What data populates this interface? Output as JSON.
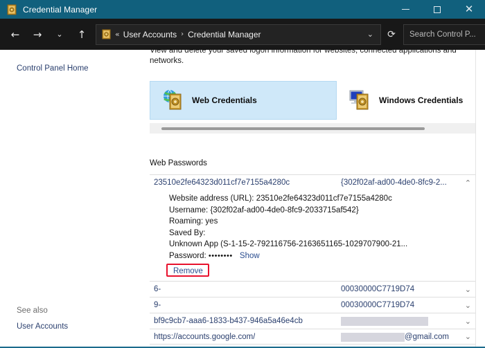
{
  "window": {
    "title": "Credential Manager",
    "icon": "vault-icon",
    "controls": {
      "minimize": "minimize-icon",
      "maximize": "maximize-icon",
      "close": "close-icon"
    }
  },
  "toolbar": {
    "back": "back-arrow-icon",
    "forward": "forward-arrow-icon",
    "recent": "chevron-down-icon",
    "up": "up-arrow-icon",
    "address": {
      "icon": "vault-icon",
      "overflow": "«",
      "crumbs": [
        "User Accounts",
        "Credential Manager"
      ],
      "separator": "›",
      "dropdown": "chevron-down-icon"
    },
    "refresh": "refresh-icon",
    "search": {
      "placeholder": "Search Control P...",
      "value": "",
      "icon": "search-icon"
    }
  },
  "sidebar": {
    "control_panel_home": "Control Panel Home",
    "see_also_label": "See also",
    "see_also_link": "User Accounts"
  },
  "main": {
    "intro": "View and delete your saved logon information for websites, connected applications and networks.",
    "tabs": [
      {
        "label": "Web Credentials",
        "icon": "globe-vault-icon",
        "selected": true
      },
      {
        "label": "Windows Credentials",
        "icon": "monitor-vault-icon",
        "selected": false
      }
    ],
    "section_title": "Web Passwords",
    "expanded_row": {
      "name": "23510e2fe64323d011cf7e7155a4280c",
      "user": "{302f02af-ad00-4de0-8fc9-2...",
      "chevron": "chevron-up-icon",
      "details": {
        "url_label": "Website address (URL):",
        "url_value": "23510e2fe64323d011cf7e7155a4280c",
        "username_label": "Username:",
        "username_value": "{302f02af-ad00-4de0-8fc9-2033715af542}",
        "roaming_label": "Roaming:",
        "roaming_value": "yes",
        "saved_by_label": "Saved By:",
        "saved_by_value": "Unknown App (S-1-15-2-792116756-2163651165-1029707900-21...",
        "password_label": "Password:",
        "password_mask": "••••••••",
        "show_link": "Show",
        "remove_link": "Remove"
      }
    },
    "rows": [
      {
        "name": "6-",
        "user": "00030000C7719D74",
        "redacted": false,
        "chevron": "chevron-down-icon"
      },
      {
        "name": "9-",
        "user": "00030000C7719D74",
        "redacted": false,
        "chevron": "chevron-down-icon"
      },
      {
        "name": "bf9c9cb7-aaa6-1833-b437-946a5a46e4cb",
        "user": "",
        "redacted": true,
        "chevron": "chevron-down-icon"
      },
      {
        "name": "https://accounts.google.com/",
        "user": "@gmail.com",
        "redacted": true,
        "chevron": "chevron-down-icon"
      }
    ]
  },
  "colors": {
    "titlebar": "#11607d",
    "toolbar": "#181818",
    "tab_selected": "#cfe8f9",
    "link": "#2a3f6e",
    "annotation": "#e8112d"
  }
}
